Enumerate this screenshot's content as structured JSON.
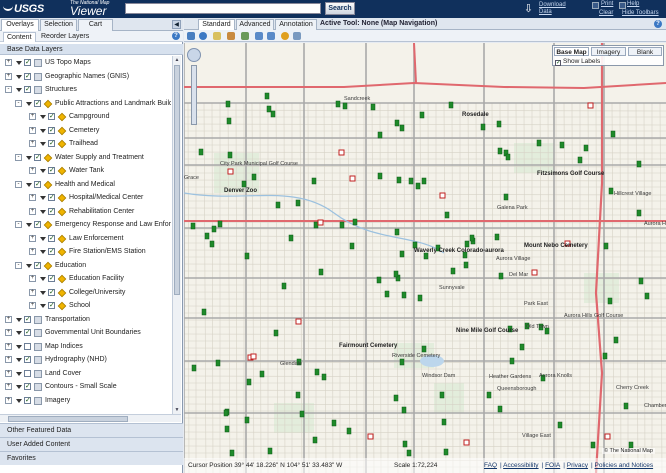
{
  "header": {
    "logo": "USGS",
    "viewer_small": "The National Map",
    "viewer_big": "Viewer",
    "search_value": "",
    "search_label": "Search",
    "download_label": "Download Data",
    "print_label": "Print",
    "help_label": "Help",
    "clear_label": "Clear",
    "hide_toolbars_label": "Hide Toolbars"
  },
  "left": {
    "tabs": [
      "Overlays",
      "Selection",
      "Cart"
    ],
    "subtabs": [
      "Content",
      "Reorder Layers"
    ],
    "base_header": "Base Data Layers",
    "layers": [
      {
        "label": "US Topo Maps",
        "level": 0,
        "expand": "+",
        "checked": true,
        "icon": "folder"
      },
      {
        "label": "Geographic Names (GNIS)",
        "level": 0,
        "expand": "+",
        "checked": true,
        "icon": "folder"
      },
      {
        "label": "Structures",
        "level": 0,
        "expand": "-",
        "checked": true,
        "icon": "folder"
      },
      {
        "label": "Public Attractions and Landmark Buildings",
        "level": 1,
        "expand": "-",
        "checked": true,
        "icon": "diamond"
      },
      {
        "label": "Campground",
        "level": 2,
        "expand": "+",
        "checked": true,
        "icon": "diamond"
      },
      {
        "label": "Cemetery",
        "level": 2,
        "expand": "+",
        "checked": true,
        "icon": "diamond"
      },
      {
        "label": "Trailhead",
        "level": 2,
        "expand": "+",
        "checked": true,
        "icon": "diamond"
      },
      {
        "label": "Water Supply and Treatment",
        "level": 1,
        "expand": "-",
        "checked": true,
        "icon": "diamond"
      },
      {
        "label": "Water Tank",
        "level": 2,
        "expand": "+",
        "checked": true,
        "icon": "diamond"
      },
      {
        "label": "Health and Medical",
        "level": 1,
        "expand": "-",
        "checked": true,
        "icon": "diamond"
      },
      {
        "label": "Hospital/Medical Center",
        "level": 2,
        "expand": "+",
        "checked": true,
        "icon": "diamond"
      },
      {
        "label": "Rehabilitation Center",
        "level": 2,
        "expand": "+",
        "checked": true,
        "icon": "diamond"
      },
      {
        "label": "Emergency Response and Law Enforcement",
        "level": 1,
        "expand": "-",
        "checked": true,
        "icon": "diamond"
      },
      {
        "label": "Law Enforcement",
        "level": 2,
        "expand": "+",
        "checked": true,
        "icon": "diamond"
      },
      {
        "label": "Fire Station/EMS Station",
        "level": 2,
        "expand": "+",
        "checked": true,
        "icon": "diamond"
      },
      {
        "label": "Education",
        "level": 1,
        "expand": "-",
        "checked": true,
        "icon": "diamond"
      },
      {
        "label": "Education Facility",
        "level": 2,
        "expand": "+",
        "checked": true,
        "icon": "diamond"
      },
      {
        "label": "College/University",
        "level": 2,
        "expand": "+",
        "checked": true,
        "icon": "diamond"
      },
      {
        "label": "School",
        "level": 2,
        "expand": "+",
        "checked": true,
        "icon": "diamond"
      },
      {
        "label": "Transportation",
        "level": 0,
        "expand": "+",
        "checked": true,
        "icon": "folder"
      },
      {
        "label": "Governmental Unit Boundaries",
        "level": 0,
        "expand": "+",
        "checked": true,
        "icon": "folder"
      },
      {
        "label": "Map Indices",
        "level": 0,
        "expand": "+",
        "checked": false,
        "icon": "folder"
      },
      {
        "label": "Hydrography (NHD)",
        "level": 0,
        "expand": "+",
        "checked": true,
        "icon": "folder"
      },
      {
        "label": "Land Cover",
        "level": 0,
        "expand": "+",
        "checked": false,
        "icon": "folder"
      },
      {
        "label": "Contours - Small Scale",
        "level": 0,
        "expand": "+",
        "checked": true,
        "icon": "folder"
      },
      {
        "label": "Imagery",
        "level": 0,
        "expand": "+",
        "checked": true,
        "icon": "folder"
      }
    ],
    "accordions": [
      "Other Featured Data",
      "User Added Content",
      "Favorites"
    ]
  },
  "map": {
    "tabs": [
      "Standard",
      "Advanced",
      "Annotation"
    ],
    "active_tool": "Active Tool: None (Map Navigation)",
    "basemap_options": [
      "Base Map",
      "Imagery",
      "Blank"
    ],
    "show_labels": "Show Labels",
    "coord_text": "Cursor Position 39° 44' 18.226\" N  104° 51' 33.483\" W",
    "scale_text": "Scale 1:72,224",
    "footer_links": [
      "FAQ",
      "Accessibility",
      "FOIA",
      "Privacy",
      "Policies and Notices"
    ],
    "attribution": "© The National Map",
    "labels": [
      "Sandcreek",
      "Rosedale",
      "Grace",
      "City Park Municipal Golf Course",
      "Denver Zoo",
      "Fitzsimons Golf Course",
      "Hillcrest Village",
      "Galena Park",
      "Aurora Hills",
      "Mount Nebo Cemetery",
      "Waverly Creek Colorado-aurora",
      "Aurora Village",
      "Del Mar",
      "Sunnyvale",
      "Park East",
      "Aurora Hills Golf Course",
      "Nine Mile Golf Course",
      "Fairmount Cemetery",
      "Riverside Cemetery",
      "Windsor Dam",
      "Glendale",
      "Heather Gardens",
      "Queensborough",
      "Village East",
      "Old Town",
      "Aurora Knolls",
      "Cherry Creek",
      "Chambers Heights"
    ]
  }
}
